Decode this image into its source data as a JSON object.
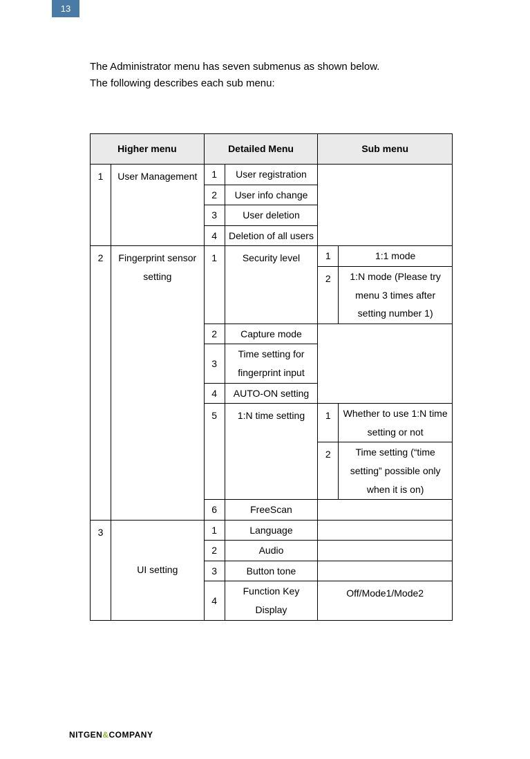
{
  "page_number": "13",
  "intro_line1": "The Administrator menu has seven submenus as shown below.",
  "intro_line2": "The following describes each sub menu:",
  "headers": {
    "higher": "Higher menu",
    "detailed": "Detailed Menu",
    "sub": "Sub menu"
  },
  "h1_num": "1",
  "h1_label": "User Management",
  "h1_d1_num": "1",
  "h1_d1_label": "User registration",
  "h1_d2_num": "2",
  "h1_d2_label": "User info change",
  "h1_d3_num": "3",
  "h1_d3_label": "User deletion",
  "h1_d4_num": "4",
  "h1_d4_label": "Deletion of all users",
  "h2_num": "2",
  "h2_label": "Fingerprint sensor setting",
  "h2_d1_num": "1",
  "h2_d1_label": "Security level",
  "h2_d1_s1_num": "1",
  "h2_d1_s1_label": "1:1 mode",
  "h2_d1_s2_num": "2",
  "h2_d1_s2_label": "1:N mode (Please try menu 3 times after setting number 1)",
  "h2_d2_num": "2",
  "h2_d2_label": "Capture mode",
  "h2_d3_num": "3",
  "h2_d3_label": "Time setting for fingerprint input",
  "h2_d4_num": "4",
  "h2_d4_label": "AUTO-ON setting",
  "h2_d5_num": "5",
  "h2_d5_label": "1:N time setting",
  "h2_d5_s1_num": "1",
  "h2_d5_s1_label": "Whether to use 1:N time setting or not",
  "h2_d5_s2_num": "2",
  "h2_d5_s2_label": "Time setting (“time setting” possible only when it is on)",
  "h2_d6_num": "6",
  "h2_d6_label": "FreeScan",
  "h3_num": "3",
  "h3_label": "UI setting",
  "h3_d1_num": "1",
  "h3_d1_label": "Language",
  "h3_d2_num": "2",
  "h3_d2_label": "Audio",
  "h3_d3_num": "3",
  "h3_d3_label": "Button tone",
  "h3_d4_num": "4",
  "h3_d4_label": "Function Key Display",
  "h3_d4_sub": "Off/Mode1/Mode2",
  "footer_brand1": "NITGEN",
  "footer_amp": "&",
  "footer_brand2": "COMPANY"
}
